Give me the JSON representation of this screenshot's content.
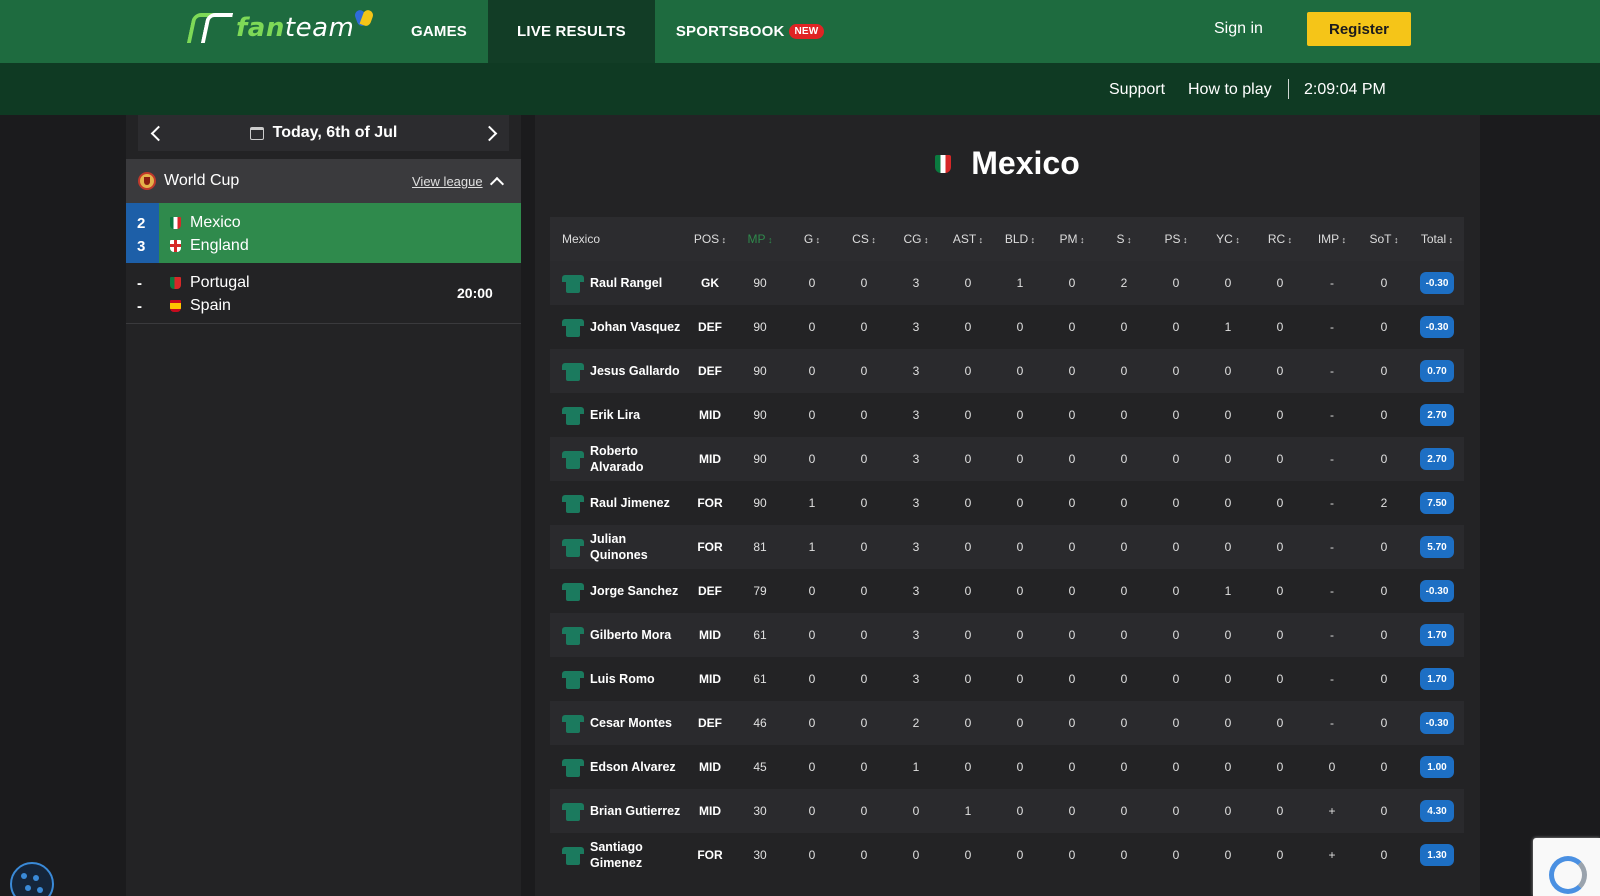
{
  "header": {
    "logo_fan": "fan",
    "logo_team": "team",
    "nav": [
      {
        "label": "GAMES"
      },
      {
        "label": "LIVE RESULTS"
      },
      {
        "label": "SPORTSBOOK"
      }
    ],
    "new_badge": "NEW",
    "sign_in": "Sign in",
    "register": "Register"
  },
  "subbar": {
    "support": "Support",
    "how_to_play": "How to play",
    "time": "2:09:04 PM"
  },
  "sidebar": {
    "date": "Today, 6th of Jul",
    "league": "World Cup",
    "view_league": "View league",
    "matches": [
      {
        "home": "Mexico",
        "away": "England",
        "home_score": "2",
        "away_score": "3",
        "kickoff": ""
      },
      {
        "home": "Portugal",
        "away": "Spain",
        "home_score": "-",
        "away_score": "-",
        "kickoff": "20:00"
      }
    ]
  },
  "main": {
    "team_name": "Mexico",
    "columns": [
      "Mexico",
      "POS",
      "MP",
      "G",
      "CS",
      "CG",
      "AST",
      "BLD",
      "PM",
      "S",
      "PS",
      "YC",
      "RC",
      "IMP",
      "SoT",
      "Total"
    ],
    "players": [
      {
        "name": "Raul Rangel",
        "pos": "GK",
        "mp": "90",
        "g": "0",
        "cs": "0",
        "cg": "3",
        "ast": "0",
        "bld": "1",
        "pm": "0",
        "s": "2",
        "ps": "0",
        "yc": "0",
        "rc": "0",
        "imp": "-",
        "sot": "0",
        "total": "-0.30"
      },
      {
        "name": "Johan Vasquez",
        "pos": "DEF",
        "mp": "90",
        "g": "0",
        "cs": "0",
        "cg": "3",
        "ast": "0",
        "bld": "0",
        "pm": "0",
        "s": "0",
        "ps": "0",
        "yc": "1",
        "rc": "0",
        "imp": "-",
        "sot": "0",
        "total": "-0.30"
      },
      {
        "name": "Jesus Gallardo",
        "pos": "DEF",
        "mp": "90",
        "g": "0",
        "cs": "0",
        "cg": "3",
        "ast": "0",
        "bld": "0",
        "pm": "0",
        "s": "0",
        "ps": "0",
        "yc": "0",
        "rc": "0",
        "imp": "-",
        "sot": "0",
        "total": "0.70"
      },
      {
        "name": "Erik Lira",
        "pos": "MID",
        "mp": "90",
        "g": "0",
        "cs": "0",
        "cg": "3",
        "ast": "0",
        "bld": "0",
        "pm": "0",
        "s": "0",
        "ps": "0",
        "yc": "0",
        "rc": "0",
        "imp": "-",
        "sot": "0",
        "total": "2.70"
      },
      {
        "name": "Roberto Alvarado",
        "pos": "MID",
        "mp": "90",
        "g": "0",
        "cs": "0",
        "cg": "3",
        "ast": "0",
        "bld": "0",
        "pm": "0",
        "s": "0",
        "ps": "0",
        "yc": "0",
        "rc": "0",
        "imp": "-",
        "sot": "0",
        "total": "2.70"
      },
      {
        "name": "Raul Jimenez",
        "pos": "FOR",
        "mp": "90",
        "g": "1",
        "cs": "0",
        "cg": "3",
        "ast": "0",
        "bld": "0",
        "pm": "0",
        "s": "0",
        "ps": "0",
        "yc": "0",
        "rc": "0",
        "imp": "-",
        "sot": "2",
        "total": "7.50"
      },
      {
        "name": "Julian Quinones",
        "pos": "FOR",
        "mp": "81",
        "g": "1",
        "cs": "0",
        "cg": "3",
        "ast": "0",
        "bld": "0",
        "pm": "0",
        "s": "0",
        "ps": "0",
        "yc": "0",
        "rc": "0",
        "imp": "-",
        "sot": "0",
        "total": "5.70"
      },
      {
        "name": "Jorge Sanchez",
        "pos": "DEF",
        "mp": "79",
        "g": "0",
        "cs": "0",
        "cg": "3",
        "ast": "0",
        "bld": "0",
        "pm": "0",
        "s": "0",
        "ps": "0",
        "yc": "1",
        "rc": "0",
        "imp": "-",
        "sot": "0",
        "total": "-0.30"
      },
      {
        "name": "Gilberto Mora",
        "pos": "MID",
        "mp": "61",
        "g": "0",
        "cs": "0",
        "cg": "3",
        "ast": "0",
        "bld": "0",
        "pm": "0",
        "s": "0",
        "ps": "0",
        "yc": "0",
        "rc": "0",
        "imp": "-",
        "sot": "0",
        "total": "1.70"
      },
      {
        "name": "Luis Romo",
        "pos": "MID",
        "mp": "61",
        "g": "0",
        "cs": "0",
        "cg": "3",
        "ast": "0",
        "bld": "0",
        "pm": "0",
        "s": "0",
        "ps": "0",
        "yc": "0",
        "rc": "0",
        "imp": "-",
        "sot": "0",
        "total": "1.70"
      },
      {
        "name": "Cesar Montes",
        "pos": "DEF",
        "mp": "46",
        "g": "0",
        "cs": "0",
        "cg": "2",
        "ast": "0",
        "bld": "0",
        "pm": "0",
        "s": "0",
        "ps": "0",
        "yc": "0",
        "rc": "0",
        "imp": "-",
        "sot": "0",
        "total": "-0.30"
      },
      {
        "name": "Edson Alvarez",
        "pos": "MID",
        "mp": "45",
        "g": "0",
        "cs": "0",
        "cg": "1",
        "ast": "0",
        "bld": "0",
        "pm": "0",
        "s": "0",
        "ps": "0",
        "yc": "0",
        "rc": "0",
        "imp": "0",
        "sot": "0",
        "total": "1.00"
      },
      {
        "name": "Brian Gutierrez",
        "pos": "MID",
        "mp": "30",
        "g": "0",
        "cs": "0",
        "cg": "0",
        "ast": "1",
        "bld": "0",
        "pm": "0",
        "s": "0",
        "ps": "0",
        "yc": "0",
        "rc": "0",
        "imp": "+",
        "sot": "0",
        "total": "4.30"
      },
      {
        "name": "Santiago Gimenez",
        "pos": "FOR",
        "mp": "30",
        "g": "0",
        "cs": "0",
        "cg": "0",
        "ast": "0",
        "bld": "0",
        "pm": "0",
        "s": "0",
        "ps": "0",
        "yc": "0",
        "rc": "0",
        "imp": "+",
        "sot": "0",
        "total": "1.30"
      }
    ]
  },
  "colors": {
    "topbar": "#1e6b3f",
    "subbar": "#0f3a23",
    "accent_yellow": "#f5c518",
    "active_match": "#2f8a4c",
    "score_pill": "#1d6fc4"
  }
}
